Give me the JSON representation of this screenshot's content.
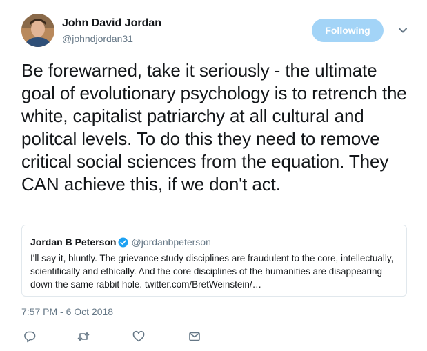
{
  "author": {
    "display_name": "John David Jordan",
    "handle": "@johndjordan31"
  },
  "follow_button": {
    "label": "Following",
    "color": "#a3d4f7"
  },
  "tweet": {
    "text": "Be forewarned, take it seriously - the ultimate goal of evolutionary psychology is to retrench the white, capitalist patriarchy at all cultural and politcal levels. To do this they need to remove critical social sciences from the equation. They CAN achieve this, if we don't act."
  },
  "quoted_tweet": {
    "display_name": "Jordan B Peterson",
    "handle": "@jordanbpeterson",
    "verified": true,
    "text": "I'll say it, bluntly. The grievance study disciplines are fraudulent to the core, intellectually, scientifically and ethically. And the core disciplines of the humanities are disappearing down the same rabbit hole. twitter.com/BretWeinstein/…"
  },
  "timestamp": "7:57 PM - 6 Oct 2018",
  "actions": [
    {
      "icon": "reply-icon"
    },
    {
      "icon": "retweet-icon"
    },
    {
      "icon": "like-icon"
    },
    {
      "icon": "direct-message-icon"
    }
  ],
  "colors": {
    "text": "#14171a",
    "secondary": "#657786",
    "border": "#e1e8ed",
    "verified": "#1da1f2"
  }
}
